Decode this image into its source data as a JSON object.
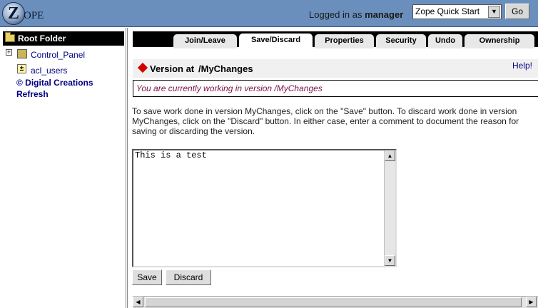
{
  "header": {
    "logo_z": "Z",
    "logo_text_big": "Z",
    "logo_text_rest": "OPE",
    "logged_in_prefix": "Logged in as",
    "logged_in_user": "manager",
    "quick_select_value": "Zope Quick Start",
    "go_label": "Go",
    "bg_color": "#6a8fbd"
  },
  "tree": {
    "root_label": "Root Folder",
    "items": [
      {
        "label": "Control_Panel",
        "icon": "control-panel-icon",
        "expander": "+"
      },
      {
        "label": "acl_users",
        "icon": "user-folder-icon"
      }
    ],
    "links": [
      "© Digital Creations",
      "Refresh"
    ]
  },
  "tabs": [
    "Join/Leave",
    "Save/Discard",
    "Properties",
    "Security",
    "Undo",
    "Ownership"
  ],
  "active_tab": "Save/Discard",
  "main": {
    "title": "Version at",
    "title_path": "/MyChanges",
    "help_label": "Help!",
    "status_message": "You are currently working in version /MyChanges",
    "instructions": "To save work done in version MyChanges, click on the \"Save\" button. To discard work done in version MyChanges, click on the \"Discard\" button. In either case, enter a comment to document the reason for saving or discarding the version.",
    "comment_value": "This is a test",
    "save_label": "Save",
    "discard_label": "Discard"
  },
  "colors": {
    "message_text": "#7a1242",
    "version_marker": "#d00000",
    "link": "#000080"
  }
}
